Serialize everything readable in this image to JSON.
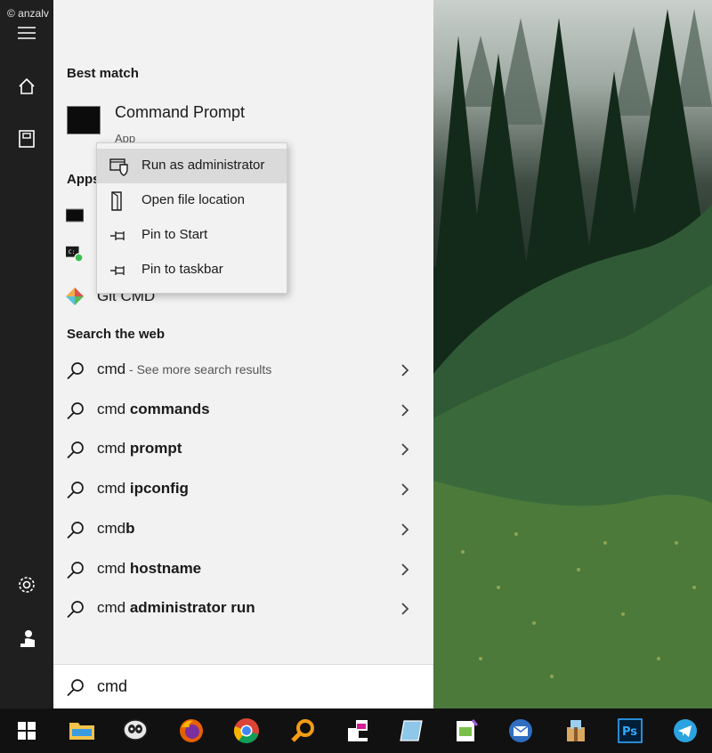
{
  "watermark": "© anzalv",
  "panel": {
    "best_match_title": "Best match",
    "best_match": {
      "name": "Command Prompt",
      "type": "App"
    },
    "apps_title": "Apps",
    "apps": [
      {
        "label": "",
        "icon": "terminal-icon"
      },
      {
        "label": "",
        "icon": "terminal-green-icon"
      },
      {
        "label": "Git CMD",
        "icon": "git-icon"
      }
    ],
    "web_title": "Search the web",
    "web_results": [
      {
        "plain": "cmd",
        "bold": "",
        "hint": " - See more search results"
      },
      {
        "plain": "cmd ",
        "bold": "commands",
        "hint": ""
      },
      {
        "plain": "cmd ",
        "bold": "prompt",
        "hint": ""
      },
      {
        "plain": "cmd ",
        "bold": "ipconfig",
        "hint": ""
      },
      {
        "plain": "cmd",
        "bold": "b",
        "hint": ""
      },
      {
        "plain": "cmd ",
        "bold": "hostname",
        "hint": ""
      },
      {
        "plain": "cmd ",
        "bold": "administrator run",
        "hint": ""
      }
    ]
  },
  "context_menu": {
    "items": [
      {
        "label": "Run as administrator",
        "icon": "shield-window-icon",
        "highlighted": true
      },
      {
        "label": "Open file location",
        "icon": "folder-page-icon",
        "highlighted": false
      },
      {
        "label": "Pin to Start",
        "icon": "pin-icon",
        "highlighted": false
      },
      {
        "label": "Pin to taskbar",
        "icon": "pin-icon",
        "highlighted": false
      }
    ]
  },
  "search": {
    "value": "cmd"
  },
  "rail_icons": [
    "hamburger-menu-icon",
    "home-icon",
    "documents-icon",
    "settings-icon",
    "user-account-icon"
  ],
  "taskbar_icons": [
    "windows-start-icon",
    "file-explorer-icon",
    "inkscape-icon",
    "firefox-icon",
    "chrome-icon",
    "search-magnifier-icon",
    "kdenlive-icon",
    "notes-icon",
    "notepad-plus-icon",
    "thunderbird-icon",
    "archive-icon",
    "photoshop-icon",
    "telegram-icon"
  ],
  "colors": {
    "rail_bg": "#1f1f1f",
    "panel_bg": "#f2f2f2",
    "highlight": "#dadada",
    "taskbar_bg": "#111111",
    "accent_blue": "#2aa3e0"
  }
}
